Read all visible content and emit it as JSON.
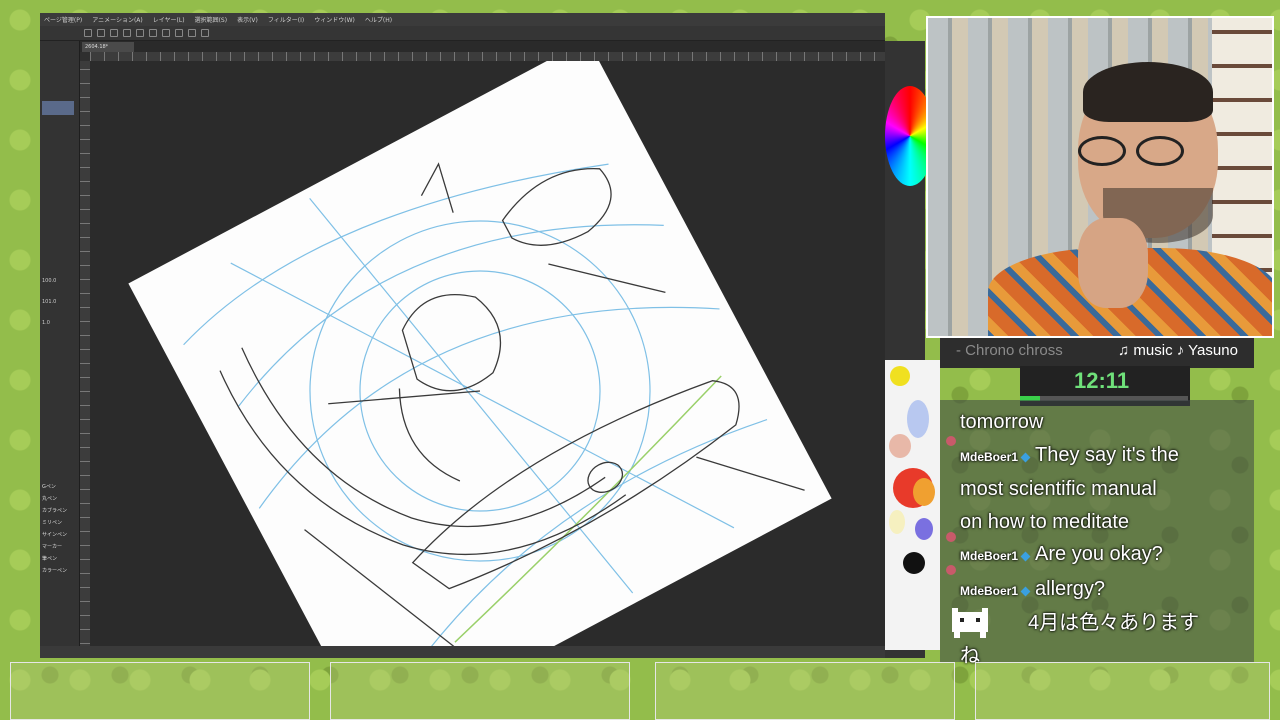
{
  "menubar": {
    "items": [
      "ページ管理(P)",
      "アニメーション(A)",
      "レイヤー(L)",
      "選択範囲(S)",
      "表示(V)",
      "フィルター(I)",
      "ウィンドウ(W)",
      "ヘルプ(H)"
    ]
  },
  "document": {
    "tab_label": "2604.18*"
  },
  "tool_panel": {
    "size_values": [
      "100.0",
      "101.0",
      "1.0"
    ],
    "brush_list": [
      "Gペン",
      "丸ペン",
      "カブラペン",
      "ミリペン",
      "サインペン",
      "マーカー",
      "筆ペン",
      "カラーペン"
    ]
  },
  "overlay": {
    "game_title": "- Chrono chross",
    "music": "♫ music ♪ Yasuno",
    "timer": "12:11",
    "timer_progress": 0.12
  },
  "chat": {
    "messages": [
      {
        "user": "",
        "text": "tomorrow"
      },
      {
        "user": "MdeBoer1",
        "text": "They say it's the"
      },
      {
        "user": "",
        "text": "most scientific manual"
      },
      {
        "user": "",
        "text": "on how to meditate"
      },
      {
        "user": "MdeBoer1",
        "text": "Are you okay?"
      },
      {
        "user": "MdeBoer1",
        "text": "allergy?"
      },
      {
        "user": "",
        "text": "4月は色々あります"
      },
      {
        "user": "",
        "text": "ね"
      }
    ]
  },
  "colors": {
    "frame_green": "#93bd4b",
    "app_bg": "#2f2f2f",
    "timer_green": "#6fe07a"
  }
}
